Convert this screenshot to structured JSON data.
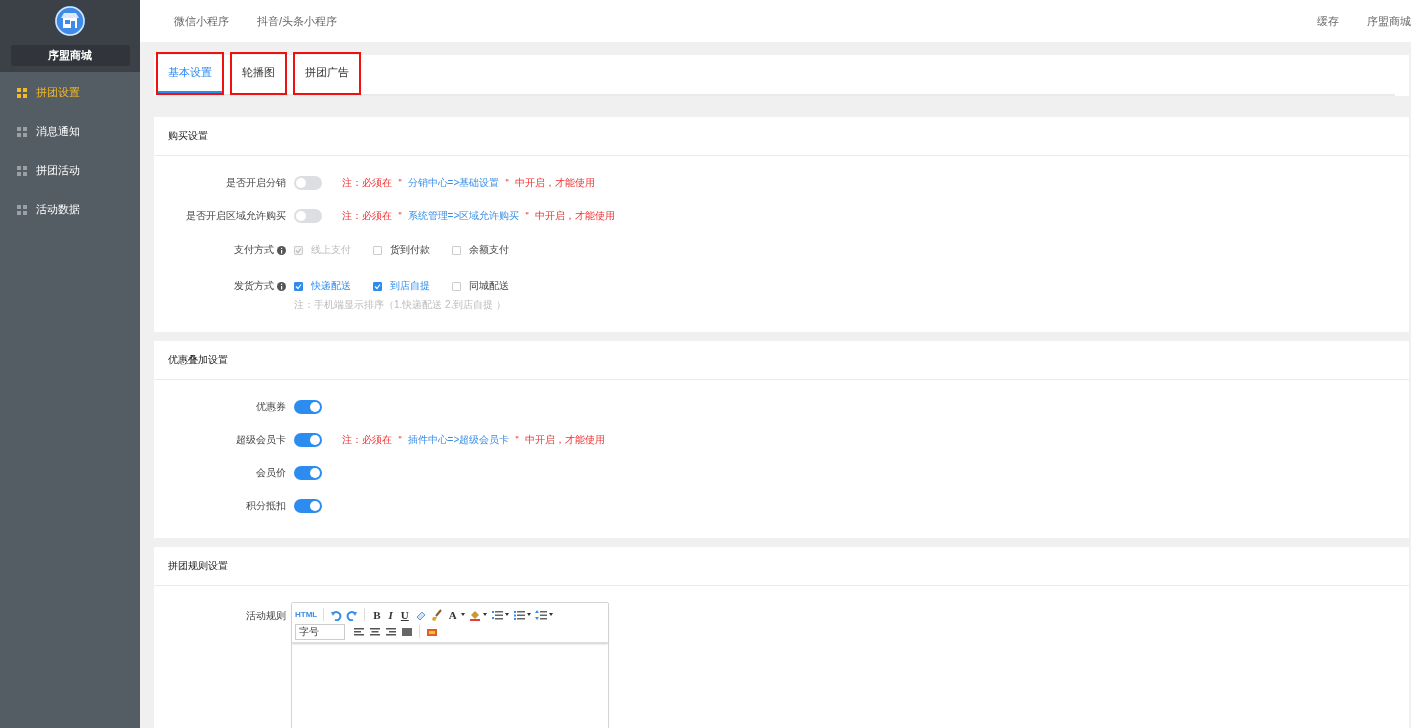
{
  "sidebar": {
    "store_name": "序盟商城",
    "items": [
      {
        "label": "拼团设置",
        "selected": true
      },
      {
        "label": "消息通知",
        "selected": false
      },
      {
        "label": "拼团活动",
        "selected": false
      },
      {
        "label": "活动数据",
        "selected": false
      }
    ]
  },
  "topbar": {
    "tabs": [
      "微信小程序",
      "抖音/头条小程序"
    ],
    "actions": [
      "缓存",
      "序盟商城"
    ]
  },
  "tabs": [
    {
      "label": "基本设置",
      "selected": true,
      "annotated": true
    },
    {
      "label": "轮播图",
      "selected": false,
      "annotated": true
    },
    {
      "label": "拼团广告",
      "selected": false,
      "annotated": true
    }
  ],
  "sections": [
    {
      "title": "购买设置",
      "rows": [
        {
          "kind": "switch",
          "label": "是否开启分销",
          "on": false,
          "note": {
            "prefix": "注：必须在 ＂",
            "path": "分销中心=>基础设置",
            "suffix": "＂ 中开启，才能使用"
          }
        },
        {
          "kind": "switch",
          "label": "是否开启区域允许购买",
          "on": false,
          "note": {
            "prefix": "注：必须在 ＂",
            "path": "系统管理=>区域允许购买",
            "suffix": "＂ 中开启，才能使用"
          }
        },
        {
          "kind": "checks",
          "label": "支付方式",
          "options": [
            {
              "label": "线上支付",
              "checked": true,
              "disabled": true
            },
            {
              "label": "货到付款",
              "checked": false,
              "disabled": false
            },
            {
              "label": "余额支付",
              "checked": false,
              "disabled": false
            }
          ]
        },
        {
          "kind": "checks",
          "label": "发货方式",
          "options": [
            {
              "label": "快递配送",
              "checked": true,
              "disabled": false
            },
            {
              "label": "到店自提",
              "checked": true,
              "disabled": false
            },
            {
              "label": "同城配送",
              "checked": false,
              "disabled": false
            }
          ],
          "hint": "注：手机端显示排序（1.快递配送 2.到店自提 ）"
        }
      ]
    },
    {
      "title": "优惠叠加设置",
      "rows": [
        {
          "kind": "switch",
          "label": "优惠券",
          "on": true
        },
        {
          "kind": "switch",
          "label": "超级会员卡",
          "on": true,
          "note": {
            "prefix": "注：必须在 ＂",
            "path": "插件中心=>超级会员卡",
            "suffix": "＂ 中开启，才能使用"
          }
        },
        {
          "kind": "switch",
          "label": "会员价",
          "on": true
        },
        {
          "kind": "switch",
          "label": "积分抵扣",
          "on": true
        }
      ]
    },
    {
      "title": "拼团规则设置",
      "rows": [
        {
          "kind": "editor",
          "label": "活动规则",
          "font_size": "字号",
          "toolbar": [
            [
              {
                "kind": "html",
                "label": "HTML"
              },
              {
                "kind": "sep"
              },
              {
                "kind": "undo"
              },
              {
                "kind": "redo"
              },
              {
                "kind": "sep"
              },
              {
                "kind": "bold",
                "label": "B"
              },
              {
                "kind": "italic",
                "label": "I"
              },
              {
                "kind": "underline",
                "label": "U"
              },
              {
                "kind": "eraser"
              },
              {
                "kind": "brush"
              },
              {
                "kind": "fontcolor",
                "label": "A"
              },
              {
                "kind": "bgcolor"
              },
              {
                "kind": "ol"
              },
              {
                "kind": "ul"
              },
              {
                "kind": "lineheight"
              }
            ],
            [
              {
                "kind": "fontsize"
              },
              {
                "kind": "left"
              },
              {
                "kind": "center"
              },
              {
                "kind": "right"
              },
              {
                "kind": "justify"
              },
              {
                "kind": "sep"
              },
              {
                "kind": "image"
              }
            ]
          ]
        }
      ]
    }
  ]
}
